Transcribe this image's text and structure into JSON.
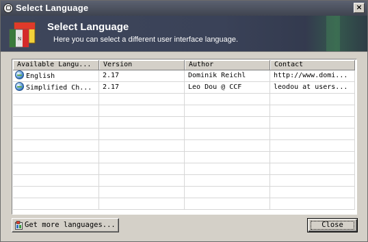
{
  "window": {
    "title": "Select Language",
    "close_symbol": "×"
  },
  "banner": {
    "heading": "Select Language",
    "subtitle": "Here you can select a different user interface language."
  },
  "table": {
    "columns": [
      "Available Langu...",
      "Version",
      "Author",
      "Contact"
    ],
    "rows": [
      {
        "language": "English",
        "version": "2.17",
        "author": "Dominik Reichl",
        "contact": "http://www.domi..."
      },
      {
        "language": "Simplified Ch...",
        "version": "2.17",
        "author": "Leo Dou @ CCF",
        "contact": "leodou at users..."
      }
    ],
    "empty_rows": 10
  },
  "buttons": {
    "get_more": "Get more languages...",
    "close": "Close"
  },
  "colors": {
    "banner": "#3e465b",
    "titlebar": "#4a505e",
    "face": "#d4d0c8"
  }
}
